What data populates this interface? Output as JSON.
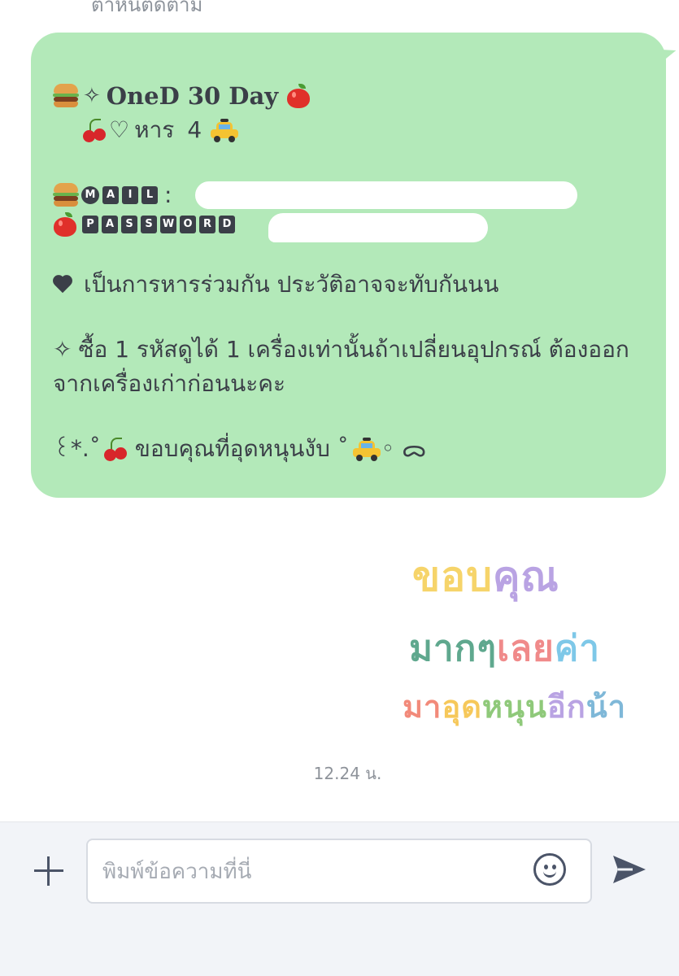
{
  "chat": {
    "top_partial_text": "ตำหนิติดตาม",
    "message": {
      "title": "OneD 30 Day",
      "subtitle_prefix": "หาร",
      "subtitle_number": "4",
      "mail_letters": [
        "M",
        "A",
        "I",
        "L"
      ],
      "password_letters": [
        "P",
        "A",
        "S",
        "S",
        "W",
        "O",
        "R",
        "D"
      ],
      "line_share": "เป็นการหารร่วมกัน ประวัติอาจจะทับกันนน",
      "line_device": "ซื้อ 1 รหัสดูได้ 1 เครื่องเท่านั้นถ้าเปลี่ยนอุปกรณ์ ต้องออกจากเครื่องเก่าก่อนนะคะ",
      "thanks_prefix": "꒰*.˚",
      "thanks_text": "ขอบคุณที่อุดหนุนงับ ˚",
      "thanks_suffix": "◦ ᯅ",
      "sparkle": "✧",
      "heart_outline": "♡",
      "colon": ":"
    },
    "sticker": {
      "line1": [
        {
          "t": "ขอบ",
          "color": "#f6d46a"
        },
        {
          "t": "คุณ",
          "color": "#b9a3e3"
        }
      ],
      "line2": [
        {
          "t": "มากๆ",
          "color": "#5fa88e"
        },
        {
          "t": "เลย",
          "color": "#f08a8a"
        },
        {
          "t": "ค่า",
          "color": "#7ec8e8"
        }
      ],
      "line3": [
        {
          "t": "มา",
          "color": "#f28a7a"
        },
        {
          "t": "อุด",
          "color": "#f6c85a"
        },
        {
          "t": "หนุน",
          "color": "#8fc97a"
        },
        {
          "t": "อีก",
          "color": "#b9a3e3"
        },
        {
          "t": "น้า",
          "color": "#7fb8d8"
        }
      ]
    },
    "timestamp": "12.24 น."
  },
  "composer": {
    "placeholder": "พิมพ์ข้อความที่นี่"
  },
  "icons": {
    "add": "plus-icon",
    "emoji": "smiley-icon",
    "send": "send-icon"
  },
  "colors": {
    "bubble": "#b3e9b9",
    "text": "#3b3f48",
    "composer_bg": "#f2f4f8",
    "icon": "#4b5468"
  }
}
